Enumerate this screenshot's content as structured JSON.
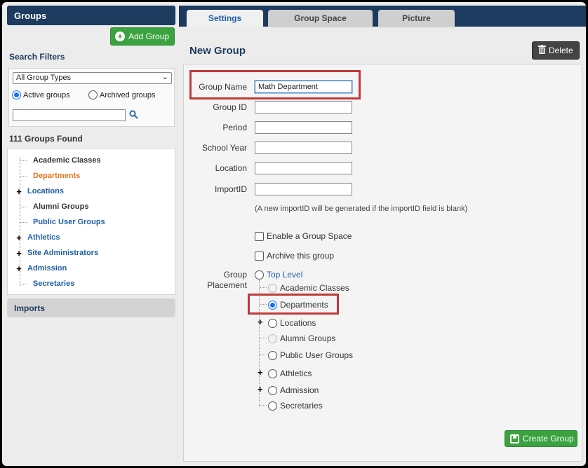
{
  "sidebar": {
    "header": "Groups",
    "add_group_label": "Add Group",
    "search_filters_title": "Search Filters",
    "group_type_selected": "All Group Types",
    "active_groups_label": "Active groups",
    "archived_groups_label": "Archived groups",
    "search_value": "",
    "groups_found": "111 Groups Found",
    "tree": [
      {
        "label": "Academic Classes",
        "expandable": false,
        "state": "dark"
      },
      {
        "label": "Departments",
        "expandable": false,
        "state": "active"
      },
      {
        "label": "Locations",
        "expandable": true,
        "state": "link"
      },
      {
        "label": "Alumni Groups",
        "expandable": false,
        "state": "dark"
      },
      {
        "label": "Public User Groups",
        "expandable": false,
        "state": "link"
      },
      {
        "label": "Athletics",
        "expandable": true,
        "state": "link"
      },
      {
        "label": "Site Administrators",
        "expandable": true,
        "state": "link"
      },
      {
        "label": "Admission",
        "expandable": true,
        "state": "link"
      },
      {
        "label": "Secretaries",
        "expandable": false,
        "state": "link"
      }
    ],
    "imports_label": "Imports"
  },
  "tabs": [
    {
      "label": "Settings",
      "active": true
    },
    {
      "label": "Group Space",
      "active": false
    },
    {
      "label": "Picture",
      "active": false
    }
  ],
  "main": {
    "title": "New Group",
    "delete_label": "Delete",
    "fields": {
      "group_name_label": "Group Name",
      "group_name_value": "Math Department",
      "group_id_label": "Group ID",
      "period_label": "Period",
      "school_year_label": "School Year",
      "location_label": "Location",
      "import_id_label": "ImportID"
    },
    "import_note": "(A new importID will be generated if the importID field is blank)",
    "enable_group_space_label": "Enable a Group Space",
    "archive_group_label": "Archive this group",
    "placement_label_line1": "Group",
    "placement_label_line2": "Placement",
    "placement_options": [
      {
        "label": "Top Level"
      },
      {
        "label": "Academic Classes"
      },
      {
        "label": "Departments"
      },
      {
        "label": "Locations"
      },
      {
        "label": "Alumni Groups"
      },
      {
        "label": "Public User Groups"
      },
      {
        "label": "Athletics"
      },
      {
        "label": "Admission"
      },
      {
        "label": "Secretaries"
      }
    ],
    "create_group_label": "Create Group"
  },
  "colors": {
    "header_navy": "#1d3a5f",
    "link_blue": "#1f5fa8",
    "active_orange": "#e8741e",
    "button_green": "#3aa23f",
    "highlight_red": "#c0393b"
  }
}
